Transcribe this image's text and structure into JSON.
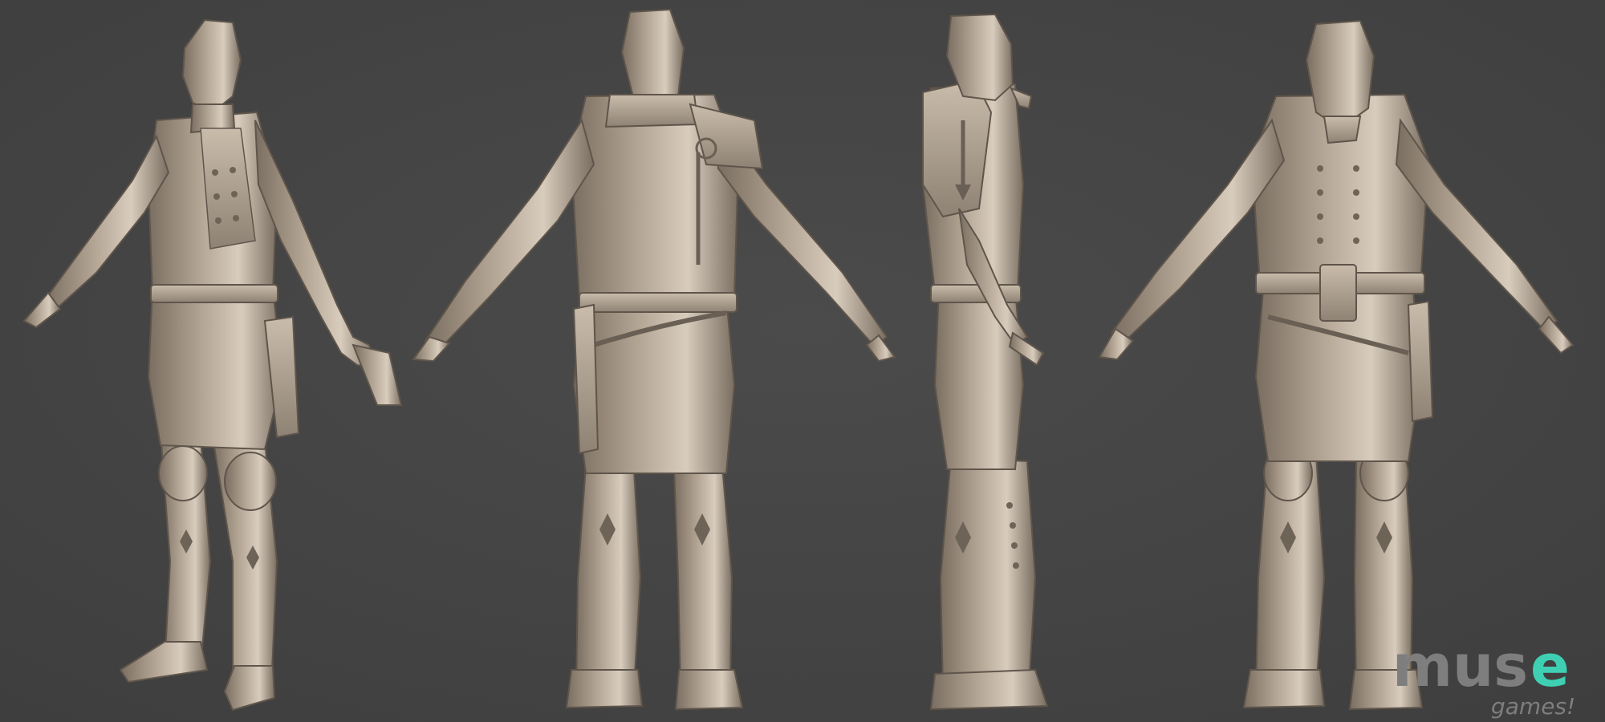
{
  "scene": {
    "background_color": "#474747",
    "clay_color": "#b3a594",
    "clay_shadow_color": "#7a6e61",
    "clay_highlight_color": "#d8ccbd",
    "views": [
      {
        "id": "three-quarter-view"
      },
      {
        "id": "back-view"
      },
      {
        "id": "side-view"
      },
      {
        "id": "front-view"
      }
    ]
  },
  "logo": {
    "wordmark": "mus",
    "accent_letter": "e",
    "tagline": "games!",
    "text_color": "#7e7e7e",
    "accent_color": "#3fd0b4"
  }
}
